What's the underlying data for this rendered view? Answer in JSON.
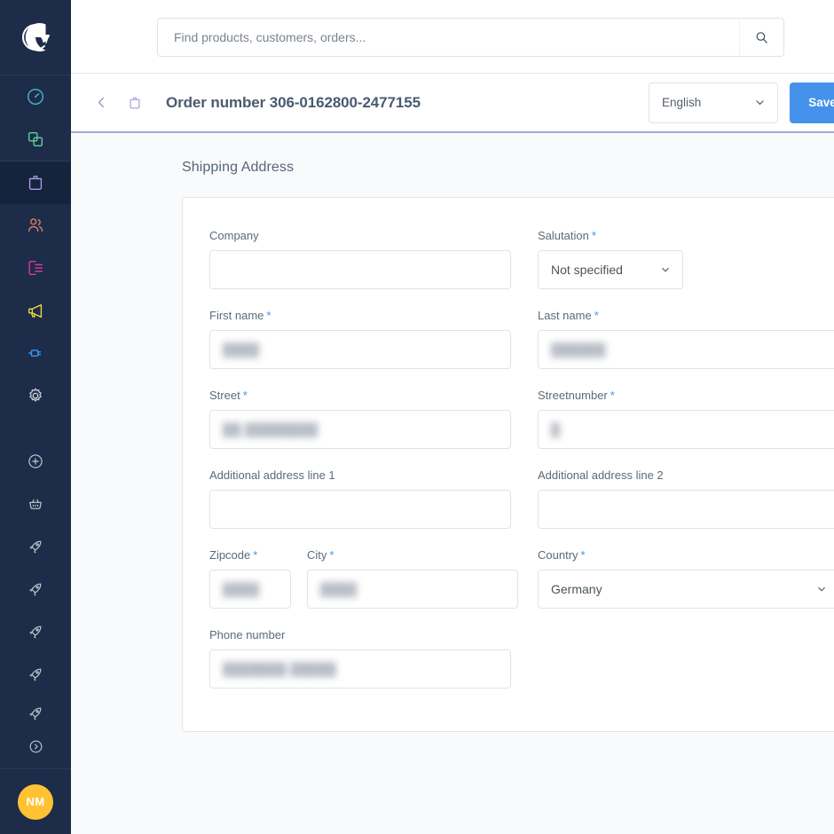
{
  "sidebar": {
    "logo_icon": "shopware-logo-icon",
    "top_items": [
      {
        "name": "dashboard",
        "icon": "dashboard-gauge-icon",
        "color": "#4eb4dd",
        "active": false
      },
      {
        "name": "catalogues",
        "icon": "catalogue-layers-icon",
        "color": "#63d09a",
        "active": false
      }
    ],
    "main_items": [
      {
        "name": "orders",
        "icon": "orders-bag-icon",
        "color": "#a99ce8",
        "active": true
      },
      {
        "name": "customers",
        "icon": "customers-people-icon",
        "color": "#e08162",
        "active": false
      },
      {
        "name": "content",
        "icon": "content-pages-icon",
        "color": "#e0399a",
        "active": false
      },
      {
        "name": "marketing",
        "icon": "marketing-megaphone-icon",
        "color": "#f0d93c",
        "active": false
      },
      {
        "name": "extensions",
        "icon": "extensions-plug-icon",
        "color": "#2f9bff",
        "active": false
      },
      {
        "name": "settings",
        "icon": "settings-gear-icon",
        "color": "#c5cbd4",
        "active": false
      }
    ],
    "app_items": [
      {
        "name": "add-app",
        "icon": "plus-circle-icon",
        "color": "#c5cbd4"
      },
      {
        "name": "shop",
        "icon": "basket-icon",
        "color": "#c5cbd4"
      },
      {
        "name": "app-1",
        "icon": "rocket-icon",
        "color": "#c5cbd4"
      },
      {
        "name": "app-2",
        "icon": "rocket-icon",
        "color": "#c5cbd4"
      },
      {
        "name": "app-3",
        "icon": "rocket-icon",
        "color": "#c5cbd4"
      },
      {
        "name": "app-4",
        "icon": "rocket-icon",
        "color": "#c5cbd4"
      },
      {
        "name": "app-5",
        "icon": "rocket-icon",
        "color": "#c5cbd4"
      },
      {
        "name": "expand",
        "icon": "chevron-right-circle-icon",
        "color": "#c5cbd4"
      }
    ],
    "avatar_initials": "NM",
    "avatar_color": "#ffc233"
  },
  "topbar": {
    "search_placeholder": "Find products, customers, orders...",
    "search_value": "",
    "search_icon": "search-icon",
    "bell_icon": "notification-bell-icon",
    "bell_has_alert": true,
    "alert_color": "#de294c"
  },
  "subheader": {
    "back_icon": "chevron-left-icon",
    "order_icon": "order-bag-icon",
    "title": "Order number 306-0162800-2477155",
    "language": "English",
    "language_options": [
      "English"
    ],
    "save_label": "Save",
    "save_color": "#4492ec"
  },
  "content": {
    "section_title": "Shipping Address",
    "fields": {
      "company": {
        "label": "Company",
        "required": false,
        "value": "",
        "redacted": false
      },
      "salutation": {
        "label": "Salutation",
        "required": true,
        "value": "Not specified",
        "type": "select"
      },
      "first_name": {
        "label": "First name",
        "required": true,
        "value": "████",
        "redacted": true
      },
      "last_name": {
        "label": "Last name",
        "required": true,
        "value": "██████",
        "redacted": true
      },
      "street": {
        "label": "Street",
        "required": true,
        "value": "██ ████████",
        "redacted": true
      },
      "streetnumber": {
        "label": "Streetnumber",
        "required": true,
        "value": "█",
        "redacted": true
      },
      "address_line_1": {
        "label": "Additional address line 1",
        "required": false,
        "value": "",
        "redacted": false
      },
      "address_line_2": {
        "label": "Additional address line 2",
        "required": false,
        "value": "",
        "redacted": false
      },
      "zipcode": {
        "label": "Zipcode",
        "required": true,
        "value": "████",
        "redacted": true
      },
      "city": {
        "label": "City",
        "required": true,
        "value": "████",
        "redacted": true
      },
      "country": {
        "label": "Country",
        "required": true,
        "value": "Germany",
        "type": "select"
      },
      "phone": {
        "label": "Phone number",
        "required": false,
        "value": "███████ █████",
        "redacted": true
      }
    },
    "required_marker": "*",
    "required_color": "#4492ec"
  }
}
